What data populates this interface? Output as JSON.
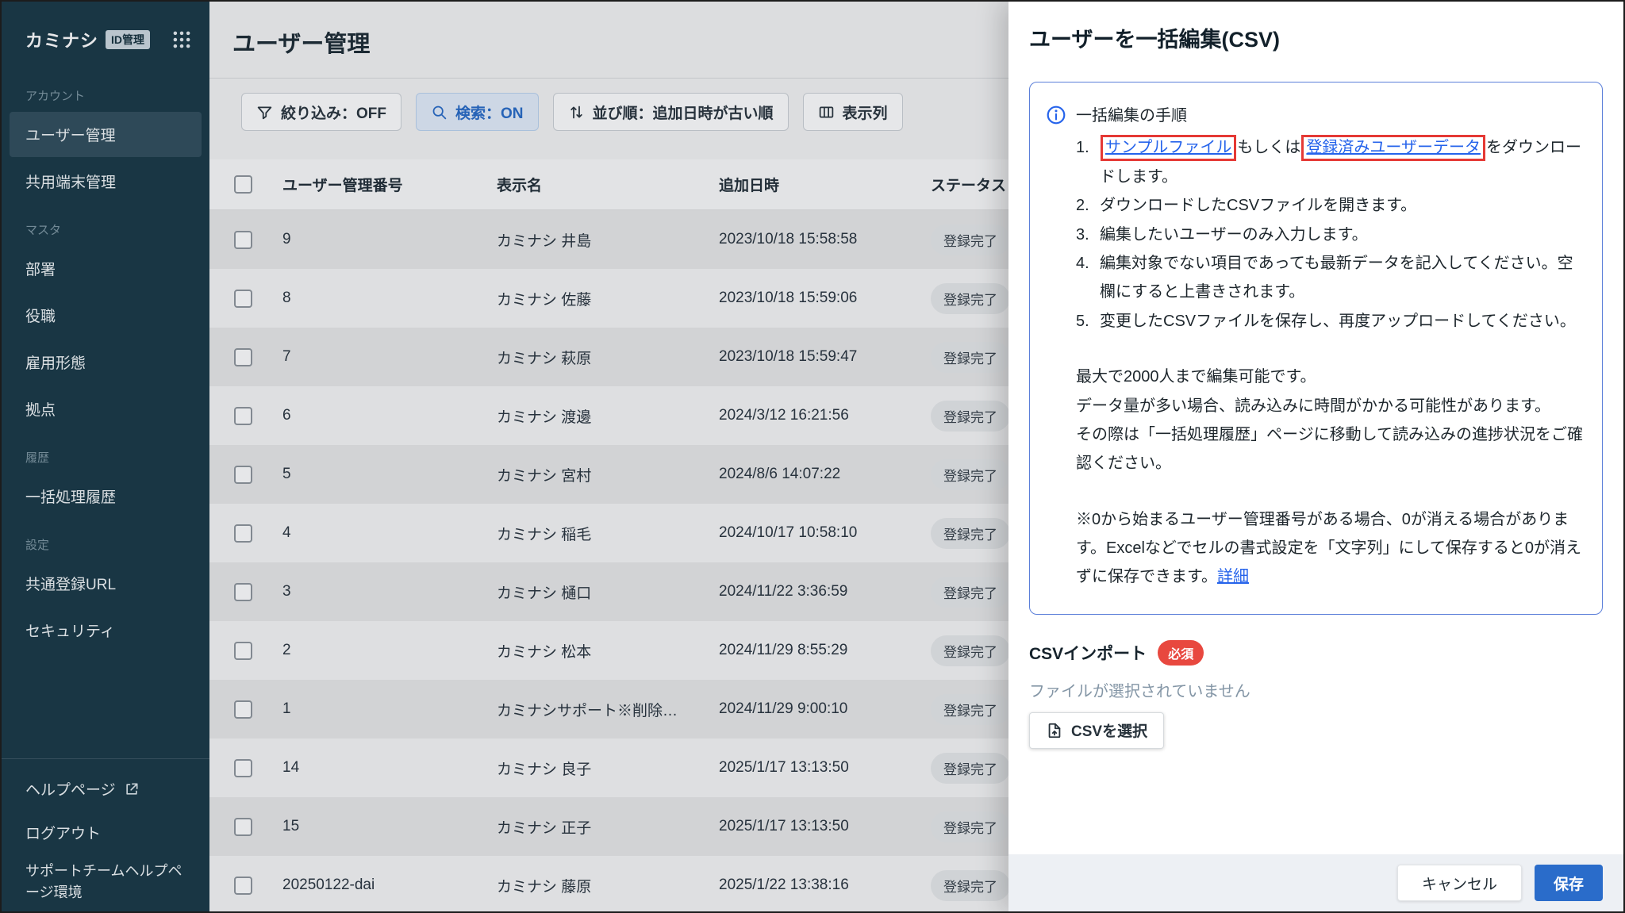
{
  "app": {
    "logo_text": "カミナシ",
    "logo_badge": "ID管理"
  },
  "colors": {
    "sidebar_bg": "#1b3a48",
    "accent_blue": "#2a6cc8",
    "link_blue": "#2563eb",
    "save_blue": "#2a6cca",
    "annotation_red": "#e53935",
    "required_red": "#e8483f",
    "status_badge_bg": "#e7e9ea"
  },
  "sidebar": {
    "sections": [
      {
        "label": "アカウント",
        "items": [
          {
            "label": "ユーザー管理",
            "active": true
          },
          {
            "label": "共用端末管理"
          }
        ]
      },
      {
        "label": "マスタ",
        "items": [
          {
            "label": "部署"
          },
          {
            "label": "役職"
          },
          {
            "label": "雇用形態"
          },
          {
            "label": "拠点"
          }
        ]
      },
      {
        "label": "履歴",
        "items": [
          {
            "label": "一括処理履歴"
          }
        ]
      },
      {
        "label": "設定",
        "items": [
          {
            "label": "共通登録URL"
          },
          {
            "label": "セキュリティ"
          }
        ]
      }
    ],
    "help": "ヘルプページ",
    "logout": "ログアウト",
    "environment": "サポートチームヘルプページ環境"
  },
  "main": {
    "title": "ユーザー管理",
    "toolbar": {
      "filter": "絞り込み：OFF",
      "search": "検索：ON",
      "sort": "並び順：追加日時が古い順",
      "columns": "表示列"
    },
    "table": {
      "headers": {
        "id": "ユーザー管理番号",
        "name": "表示名",
        "added": "追加日時",
        "status": "ステータス"
      },
      "rows": [
        {
          "id": "9",
          "name": "カミナシ 井島",
          "added": "2023/10/18 15:58:58",
          "status": "登録完了"
        },
        {
          "id": "8",
          "name": "カミナシ 佐藤",
          "added": "2023/10/18 15:59:06",
          "status": "登録完了"
        },
        {
          "id": "7",
          "name": "カミナシ 萩原",
          "added": "2023/10/18 15:59:47",
          "status": "登録完了"
        },
        {
          "id": "6",
          "name": "カミナシ 渡邊",
          "added": "2024/3/12 16:21:56",
          "status": "登録完了"
        },
        {
          "id": "5",
          "name": "カミナシ 宮村",
          "added": "2024/8/6 14:07:22",
          "status": "登録完了"
        },
        {
          "id": "4",
          "name": "カミナシ 稲毛",
          "added": "2024/10/17 10:58:10",
          "status": "登録完了"
        },
        {
          "id": "3",
          "name": "カミナシ 樋口",
          "added": "2024/11/22 3:36:59",
          "status": "登録完了"
        },
        {
          "id": "2",
          "name": "カミナシ 松本",
          "added": "2024/11/29 8:55:29",
          "status": "登録完了"
        },
        {
          "id": "1",
          "name": "カミナシサポート※削除…",
          "added": "2024/11/29 9:00:10",
          "status": "登録完了"
        },
        {
          "id": "14",
          "name": "カミナシ 良子",
          "added": "2025/1/17 13:13:50",
          "status": "登録完了"
        },
        {
          "id": "15",
          "name": "カミナシ 正子",
          "added": "2025/1/17 13:13:50",
          "status": "登録完了"
        },
        {
          "id": "20250122-dai",
          "name": "カミナシ 藤原",
          "added": "2025/1/22 13:38:16",
          "status": "登録完了"
        }
      ]
    }
  },
  "drawer": {
    "title": "ユーザーを一括編集(CSV)",
    "guide": {
      "heading": "一括編集の手順",
      "step1_num": "1.",
      "link_sample": "サンプルファイル",
      "step1_mid": "もしくは",
      "link_registered": "登録済みユーザーデータ",
      "step1_suffix": "をダウンロードします。",
      "steps_rest": [
        {
          "num": "2.",
          "text": "ダウンロードしたCSVファイルを開きます。"
        },
        {
          "num": "3.",
          "text": "編集したいユーザーのみ入力します。"
        },
        {
          "num": "4.",
          "text": "編集対象でない項目であっても最新データを記入してください。空欄にすると上書きされます。"
        },
        {
          "num": "5.",
          "text": "変更したCSVファイルを保存し、再度アップロードしてください。"
        }
      ],
      "para1_lines": [
        "最大で2000人まで編集可能です。",
        "データ量が多い場合、読み込みに時間がかかる可能性があります。",
        "その際は「一括処理履歴」ページに移動して読み込みの進捗状況をご確認ください。"
      ],
      "para2": "※0から始まるユーザー管理番号がある場合、0が消える場合があります。Excelなどでセルの書式設定を「文字列」にして保存すると0が消えずに保存できます。",
      "link_detail": "詳細"
    },
    "import": {
      "label": "CSVインポート",
      "required_badge": "必須",
      "no_file": "ファイルが選択されていません",
      "select_button": "CSVを選択"
    },
    "footer": {
      "cancel": "キャンセル",
      "save": "保存"
    }
  }
}
